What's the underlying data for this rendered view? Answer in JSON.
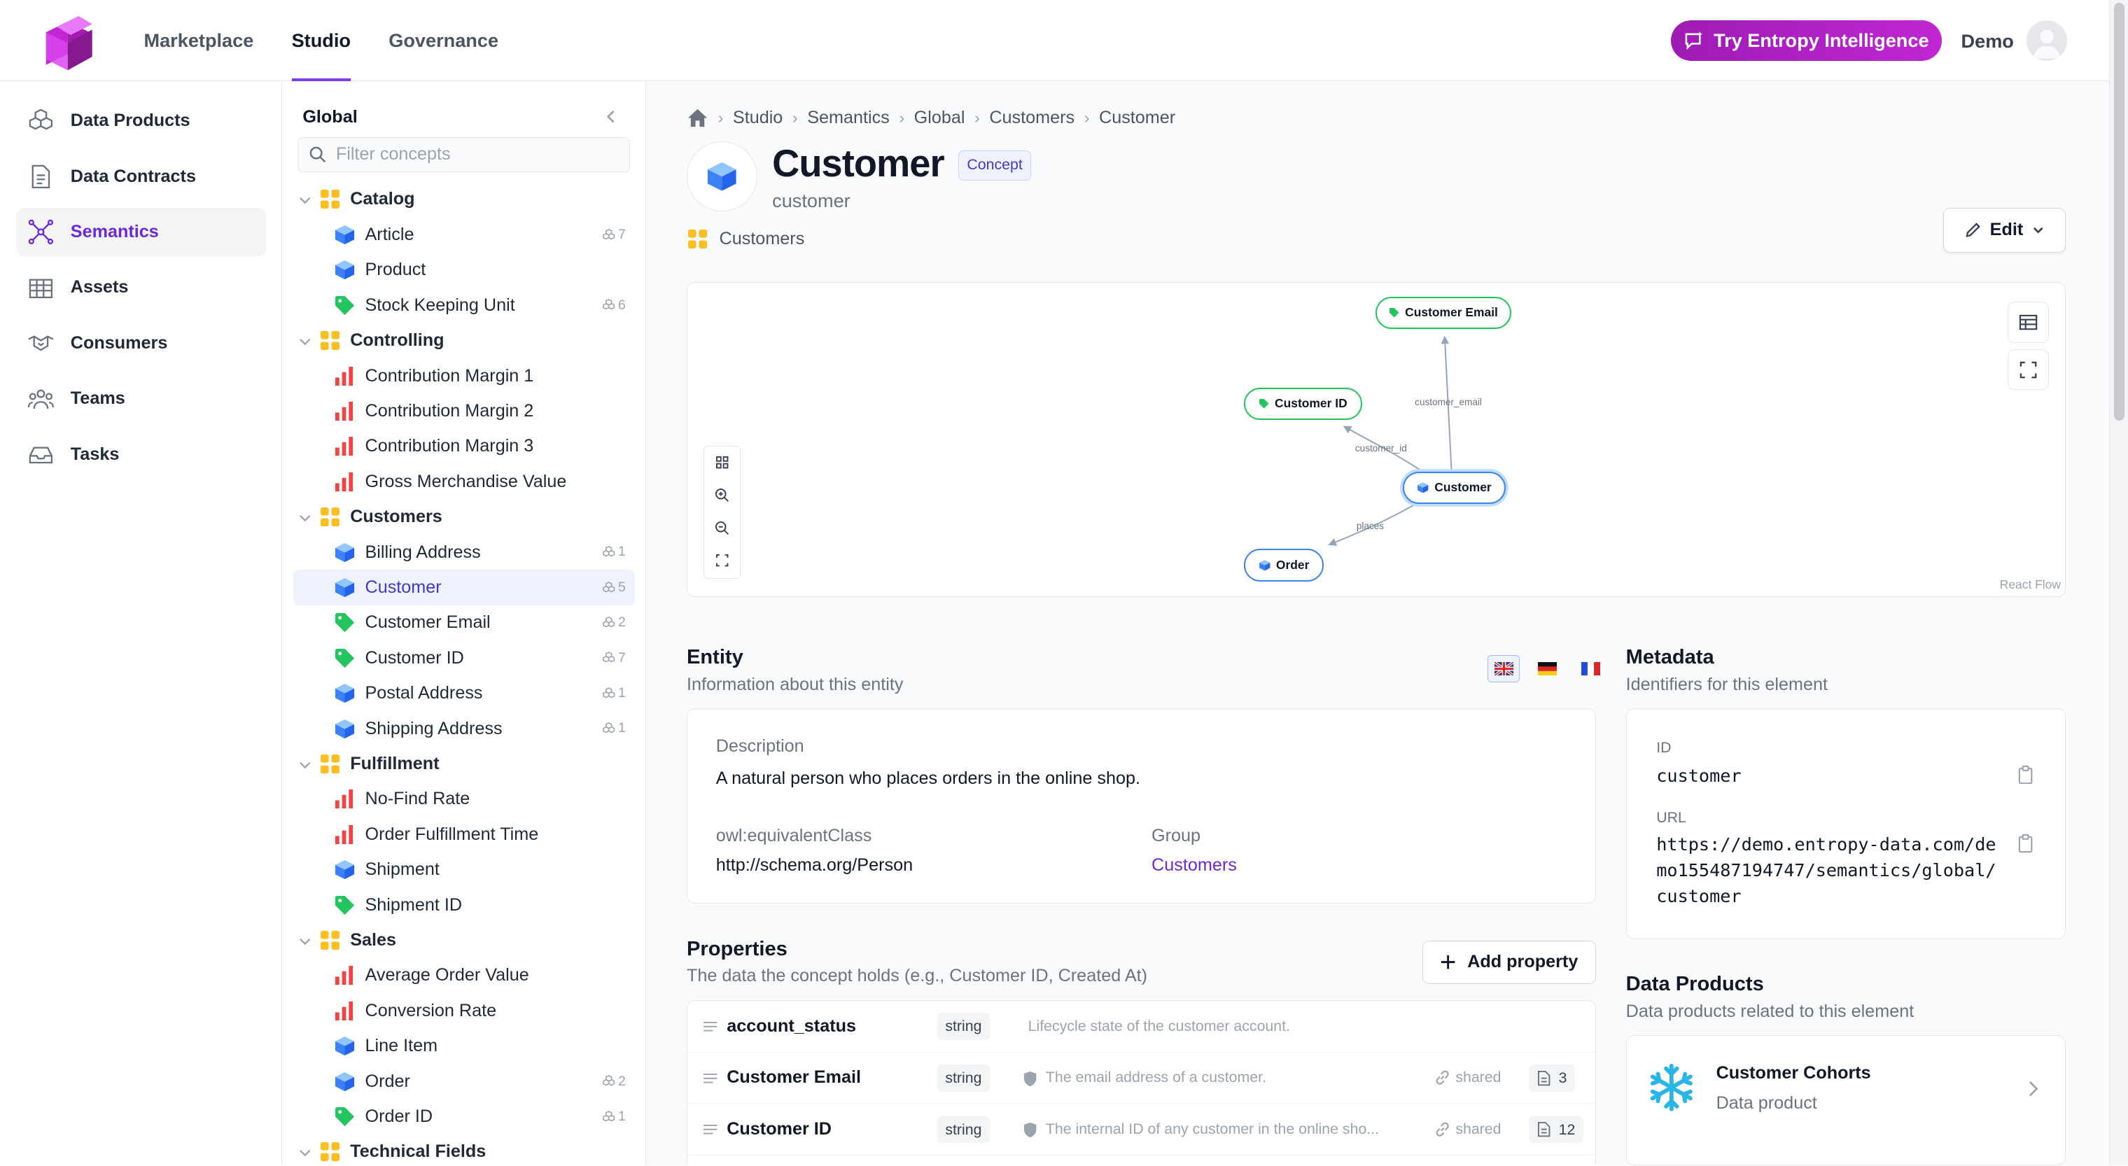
{
  "topnav": {
    "tabs": [
      {
        "label": "Marketplace"
      },
      {
        "label": "Studio"
      },
      {
        "label": "Governance"
      }
    ]
  },
  "topbar": {
    "try_label": "Try Entropy Intelligence",
    "user": "Demo"
  },
  "leftnav": {
    "items": [
      {
        "label": "Data Products",
        "icon": "cubes-icon"
      },
      {
        "label": "Data Contracts",
        "icon": "document-icon"
      },
      {
        "label": "Semantics",
        "icon": "network-icon"
      },
      {
        "label": "Assets",
        "icon": "table-icon"
      },
      {
        "label": "Consumers",
        "icon": "handshake-icon"
      },
      {
        "label": "Teams",
        "icon": "people-icon"
      },
      {
        "label": "Tasks",
        "icon": "inbox-icon"
      }
    ]
  },
  "tree": {
    "title": "Global",
    "filter_placeholder": "Filter concepts",
    "groups": [
      {
        "label": "Catalog"
      },
      {
        "label": "Controlling"
      },
      {
        "label": "Customers"
      },
      {
        "label": "Fulfillment"
      },
      {
        "label": "Sales"
      },
      {
        "label": "Technical Fields"
      }
    ],
    "items": [
      {
        "label": "Article",
        "count": "7",
        "kind": "entity"
      },
      {
        "label": "Product",
        "count": "",
        "kind": "entity"
      },
      {
        "label": "Stock Keeping Unit",
        "count": "6",
        "kind": "attribute"
      },
      {
        "label": "Contribution Margin 1",
        "count": "",
        "kind": "metric"
      },
      {
        "label": "Contribution Margin 2",
        "count": "",
        "kind": "metric"
      },
      {
        "label": "Contribution Margin 3",
        "count": "",
        "kind": "metric"
      },
      {
        "label": "Gross Merchandise Value",
        "count": "",
        "kind": "metric"
      },
      {
        "label": "Billing Address",
        "count": "1",
        "kind": "entity"
      },
      {
        "label": "Customer",
        "count": "5",
        "kind": "entity"
      },
      {
        "label": "Customer Email",
        "count": "2",
        "kind": "attribute"
      },
      {
        "label": "Customer ID",
        "count": "7",
        "kind": "attribute"
      },
      {
        "label": "Postal Address",
        "count": "1",
        "kind": "entity"
      },
      {
        "label": "Shipping Address",
        "count": "1",
        "kind": "entity"
      },
      {
        "label": "No-Find Rate",
        "count": "",
        "kind": "metric"
      },
      {
        "label": "Order Fulfillment Time",
        "count": "",
        "kind": "metric"
      },
      {
        "label": "Shipment",
        "count": "",
        "kind": "entity"
      },
      {
        "label": "Shipment ID",
        "count": "",
        "kind": "attribute"
      },
      {
        "label": "Average Order Value",
        "count": "",
        "kind": "metric"
      },
      {
        "label": "Conversion Rate",
        "count": "",
        "kind": "metric"
      },
      {
        "label": "Line Item",
        "count": "",
        "kind": "entity"
      },
      {
        "label": "Order",
        "count": "2",
        "kind": "entity"
      },
      {
        "label": "Order ID",
        "count": "1",
        "kind": "attribute"
      }
    ]
  },
  "breadcrumb": [
    "Studio",
    "Semantics",
    "Global",
    "Customers",
    "Customer"
  ],
  "header": {
    "title": "Customer",
    "badge": "Concept",
    "subtitle": "customer",
    "group": "Customers",
    "edit_label": "Edit"
  },
  "graph": {
    "nodes": {
      "email": "Customer Email",
      "id": "Customer ID",
      "customer": "Customer",
      "order": "Order"
    },
    "edges": {
      "email": "customer_email",
      "id": "customer_id",
      "places": "places"
    },
    "attribution": "React Flow"
  },
  "entity": {
    "title": "Entity",
    "subtitle": "Information about this entity",
    "description_label": "Description",
    "description": "A natural person who places orders in the online shop.",
    "equiv_label": "owl:equivalentClass",
    "equiv_value": "http://schema.org/Person",
    "group_label": "Group",
    "group_value": "Customers"
  },
  "metadata": {
    "title": "Metadata",
    "subtitle": "Identifiers for this element",
    "id_label": "ID",
    "id_value": "customer",
    "url_label": "URL",
    "url_line1": "https://demo.entropy-data.com/de",
    "url_line2": "mo155487194747/semantics/global/",
    "url_line3": "customer"
  },
  "properties": {
    "title": "Properties",
    "subtitle": "The data the concept holds (e.g., Customer ID, Created At)",
    "add_label": "Add property",
    "rows": [
      {
        "name": "account_status",
        "type": "string",
        "desc": "Lifecycle state of the customer account.",
        "shared": "",
        "uses": ""
      },
      {
        "name": "Customer Email",
        "type": "string",
        "desc": "The email address of a customer.",
        "shared": "shared",
        "uses": "3"
      },
      {
        "name": "Customer ID",
        "type": "string",
        "desc": "The internal ID of any customer in the online sho...",
        "shared": "shared",
        "uses": "12"
      }
    ]
  },
  "data_products": {
    "title": "Data Products",
    "subtitle": "Data products related to this element",
    "card_title": "Customer Cohorts",
    "card_sub": "Data product"
  },
  "colors": {
    "accent": "#6d28d9",
    "brand_gradient_start": "#9d1cb3",
    "brand_gradient_end": "#c026d3",
    "attribute": "#22c55e",
    "entity": "#3b82f6",
    "group": "#fbbf24",
    "metric": "#ef4444"
  }
}
